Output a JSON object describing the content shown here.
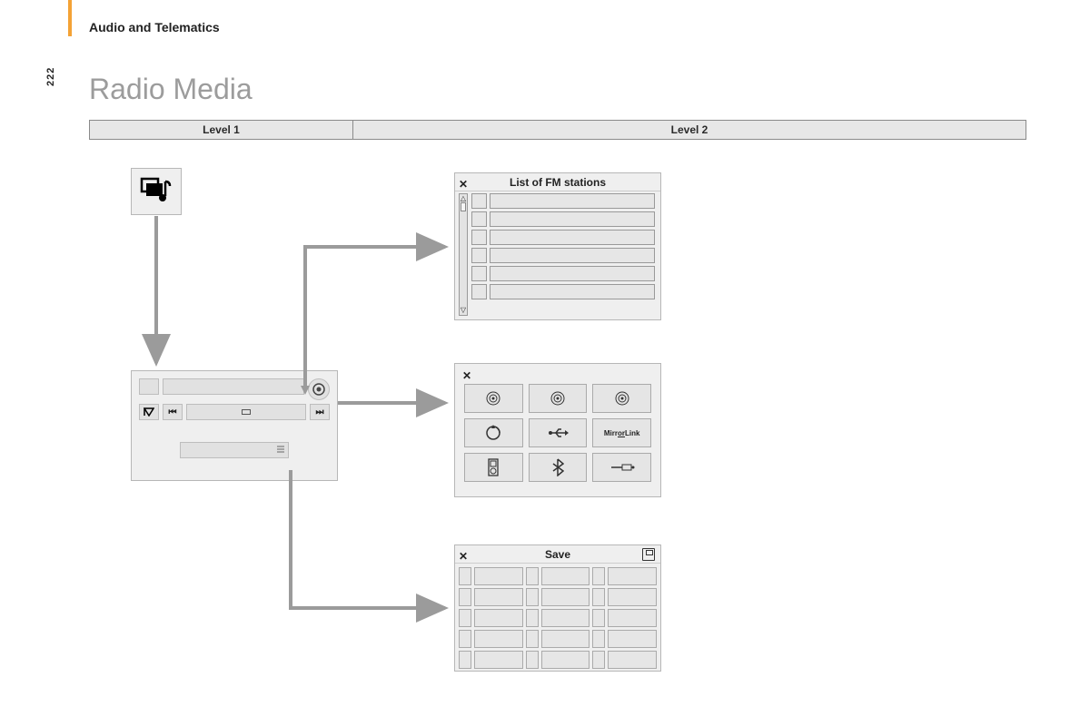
{
  "header": {
    "section": "Audio and Telematics",
    "page_number": "222",
    "title": "Radio Media"
  },
  "levels": {
    "col1": "Level 1",
    "col2": "Level 2"
  },
  "fm_panel": {
    "title": "List of FM stations",
    "close": "✕"
  },
  "sources_panel": {
    "close": "✕",
    "sources": [
      "radio-dab",
      "radio-fm",
      "radio-am",
      "cd",
      "usb",
      "MirrorLink",
      "ipod",
      "bluetooth",
      "aux"
    ]
  },
  "save_panel": {
    "title": "Save",
    "close": "✕"
  },
  "icons": {
    "media": "music-stack-icon",
    "player_out": "eject",
    "prev": "⏮",
    "next": "⏭"
  }
}
